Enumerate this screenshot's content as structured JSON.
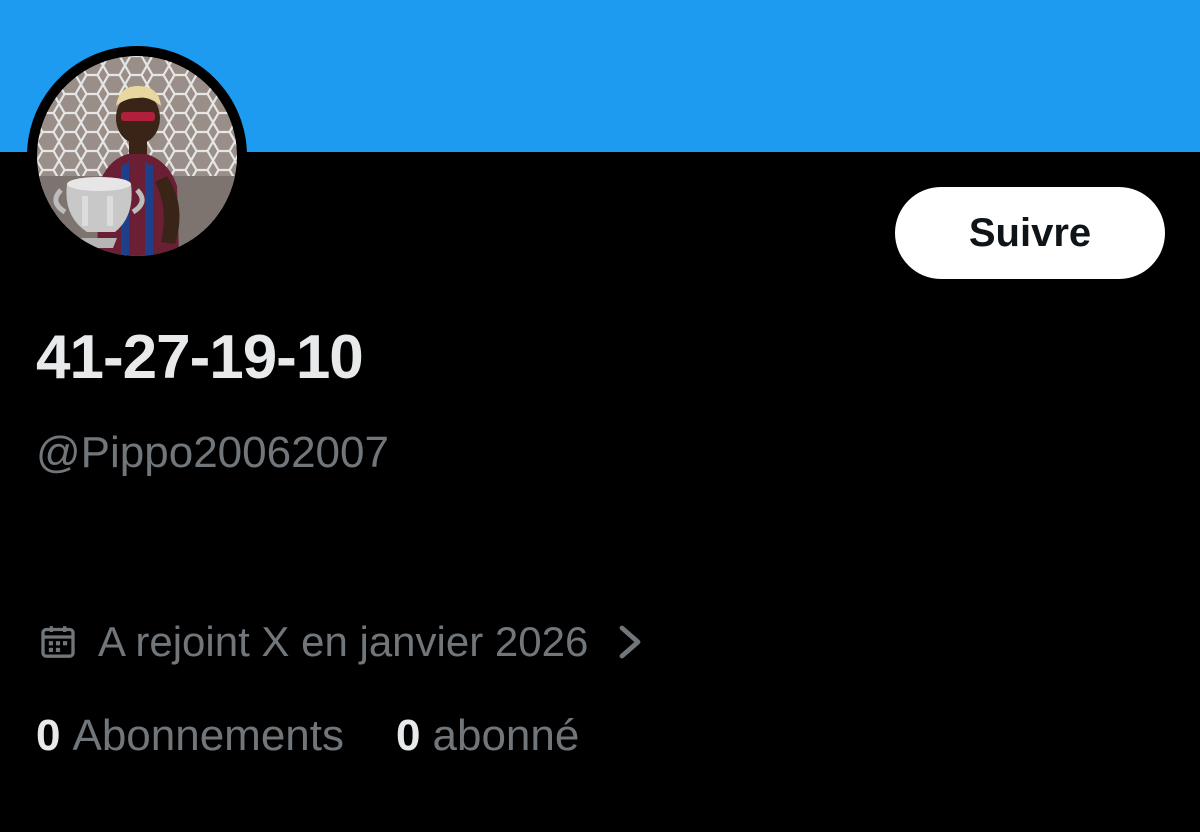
{
  "colors": {
    "banner": "#1d9bf0",
    "background": "#000000",
    "text_primary": "#e7e9ea",
    "text_secondary": "#71767b",
    "follow_button_bg": "#ffffff",
    "follow_button_text": "#0f1419"
  },
  "profile": {
    "display_name": "41-27-19-10",
    "handle": "@Pippo20062007",
    "avatar_icon": "avatar-photo-player-with-trophy"
  },
  "actions": {
    "follow_label": "Suivre"
  },
  "meta": {
    "calendar_icon": "calendar-icon",
    "joined_text": "A rejoint X en janvier 2026",
    "chevron_icon": "chevron-right-icon"
  },
  "stats": {
    "following_count": "0",
    "following_label": "Abonnements",
    "followers_count": "0",
    "followers_label": "abonné"
  }
}
